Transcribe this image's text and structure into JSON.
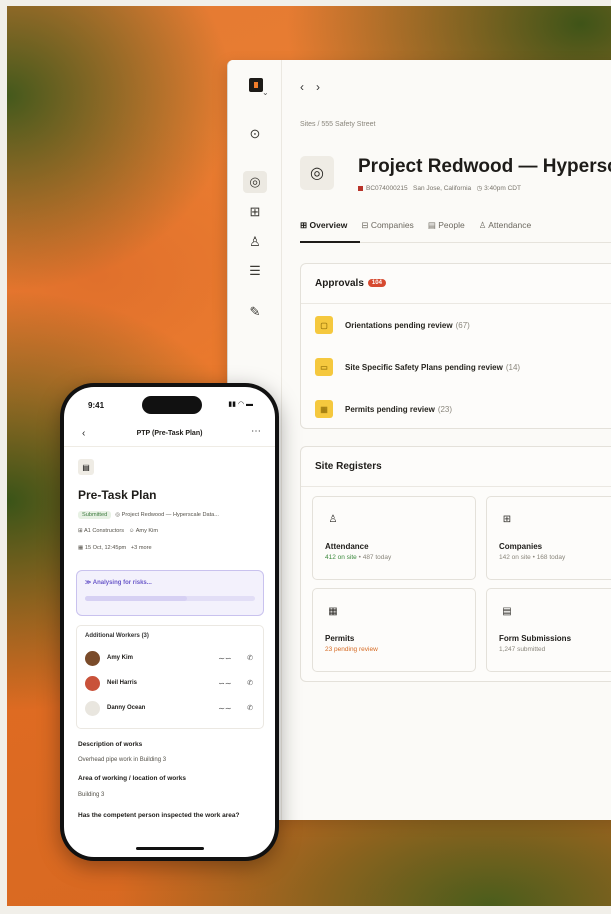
{
  "desktop": {
    "breadcrumb": "Sites  /  555 Safety Street",
    "project": {
      "title": "Project Redwood — Hypersca",
      "code": "BC074000215",
      "location": "San Jose, California",
      "time": "3:40pm CDT"
    },
    "tabs": [
      {
        "label": "Overview",
        "icon": "grid-icon"
      },
      {
        "label": "Companies",
        "icon": "building-icon"
      },
      {
        "label": "People",
        "icon": "id-card-icon"
      },
      {
        "label": "Attendance",
        "icon": "people-icon"
      }
    ],
    "approvals": {
      "title": "Approvals",
      "badge": "104",
      "items": [
        {
          "label": "Orientations pending review",
          "count": "(67)"
        },
        {
          "label": "Site Specific Safety Plans pending review",
          "count": "(14)"
        },
        {
          "label": "Permits pending review",
          "count": "(23)"
        }
      ]
    },
    "registers": {
      "title": "Site Registers",
      "tiles": [
        {
          "name": "Attendance",
          "highlight": "412 on site",
          "rest": " • 487 today"
        },
        {
          "name": "Companies",
          "highlight": "",
          "rest": "142 on site • 168 today"
        },
        {
          "name": "Permits",
          "highlight": "23 pending review",
          "rest": ""
        },
        {
          "name": "Form Submissions",
          "highlight": "",
          "rest": "1,247 submitted"
        }
      ]
    }
  },
  "phone": {
    "status_time": "9:41",
    "header_title": "PTP (Pre-Task Plan)",
    "title": "Pre-Task Plan",
    "status_chip": "Submitted",
    "project_ref": "Project Redwood — Hyperscale Data...",
    "company": "A1 Constructors",
    "person": "Amy Kim",
    "datetime": "15 Oct, 12:45pm",
    "more": "+3 more",
    "analysing": "Analysing for risks...",
    "workers_header": "Additional Workers (3)",
    "workers": [
      "Amy Kim",
      "Neil Harris",
      "Danny Ocean"
    ],
    "q1": "Description of works",
    "a1": "Overhead pipe work in Building 3",
    "q2": "Area of working / location of works",
    "a2": "Building 3",
    "q3": "Has the competent person inspected the work area?"
  }
}
